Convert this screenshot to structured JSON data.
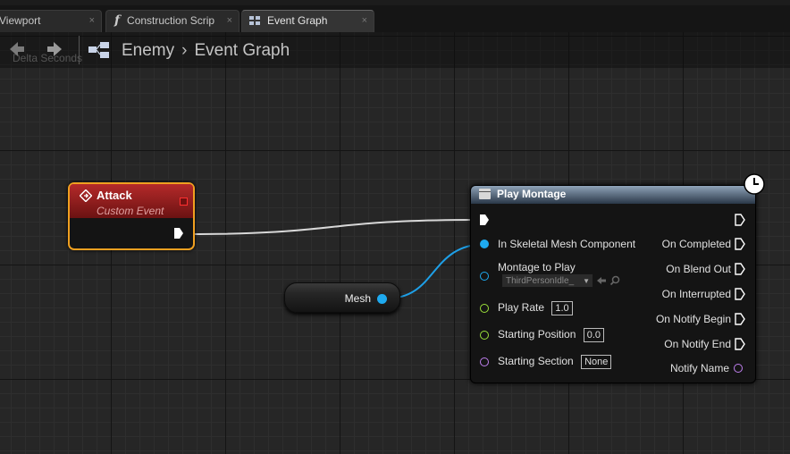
{
  "tabs": [
    {
      "label": "Viewport",
      "close": "×"
    },
    {
      "label": "Construction Scrip",
      "close": "×",
      "icon": "function-icon"
    },
    {
      "label": "Event Graph",
      "close": "×",
      "icon": "event-graph-icon"
    }
  ],
  "breadcrumb": {
    "blueprint": "Enemy",
    "graph": "Event Graph"
  },
  "ghost_text": "Delta Seconds",
  "nodes": {
    "attack": {
      "title": "Attack",
      "subtitle": "Custom Event"
    },
    "mesh": {
      "label": "Mesh"
    },
    "play_montage": {
      "title": "Play Montage",
      "inputs": {
        "skeletal_mesh": "In Skeletal Mesh Component",
        "montage": "Montage to Play",
        "montage_value": "ThirdPersonIdle_",
        "play_rate": "Play Rate",
        "play_rate_value": "1.0",
        "starting_position": "Starting Position",
        "starting_position_value": "0.0",
        "starting_section": "Starting Section",
        "starting_section_value": "None"
      },
      "outputs": {
        "on_completed": "On Completed",
        "on_blend_out": "On Blend Out",
        "on_interrupted": "On Interrupted",
        "on_notify_begin": "On Notify Begin",
        "on_notify_end": "On Notify End",
        "notify_name": "Notify Name"
      }
    }
  },
  "colors": {
    "exec": "#ffffff",
    "object_pin": "#1eaaf0",
    "float_pin": "#9be03a",
    "name_pin": "#c080f0",
    "event_header": "#a82020",
    "selection": "#f0a020"
  }
}
